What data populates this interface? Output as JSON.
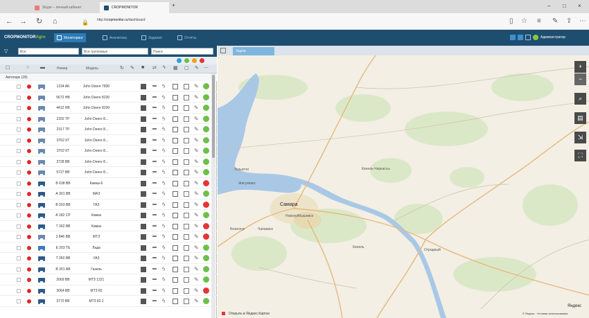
{
  "browser": {
    "tabs": [
      {
        "label": "Skype – личный кабинет",
        "active": false
      },
      {
        "label": "CROPMONITOR",
        "active": true
      }
    ],
    "url_prefix": "http://",
    "url_host": "cropmonitor.ru",
    "url_path": "/dashboard"
  },
  "header": {
    "logo_main": "CROPMONITOR",
    "logo_sub": "Agro",
    "nav": [
      {
        "label": "Мониторинг",
        "active": true
      },
      {
        "label": "Аналитика",
        "active": false
      },
      {
        "label": "Задания",
        "active": false
      },
      {
        "label": "Отчёты",
        "active": false
      }
    ],
    "user": "Администратор"
  },
  "filters": {
    "group": "Все",
    "type": "Все групповые",
    "search_placeholder": "Поиск"
  },
  "status_dots": [
    "#2a9fe0",
    "#6cc04a",
    "#f0a020",
    "#e43535"
  ],
  "columns": {
    "plate": "Номер",
    "model": "Модель"
  },
  "group_label": "Автопарк (28)",
  "vehicles": [
    {
      "kind": "tractor",
      "plate": "1234 AK",
      "model": "John Deere 7830",
      "ok": true
    },
    {
      "kind": "tractor",
      "plate": "5672 НВ",
      "model": "John Deere 8230",
      "ok": true
    },
    {
      "kind": "tractor",
      "plate": "4412 НВ",
      "model": "John Deere 8230",
      "ok": true
    },
    {
      "kind": "tractor",
      "plate": "2202 ТР",
      "model": "John Deere 8...",
      "ok": true
    },
    {
      "kind": "tractor",
      "plate": "2317 ТР",
      "model": "John Deere 8...",
      "ok": true
    },
    {
      "kind": "tractor",
      "plate": "0762 КТ",
      "model": "John Deere 8...",
      "ok": true
    },
    {
      "kind": "tractor",
      "plate": "3702 КТ",
      "model": "John Deere 8...",
      "ok": true
    },
    {
      "kind": "tractor",
      "plate": "3728 ВВ",
      "model": "John Deere 8...",
      "ok": true
    },
    {
      "kind": "tractor",
      "plate": "5727 ВВ",
      "model": "John Deere 8...",
      "ok": true
    },
    {
      "kind": "truck",
      "plate": "В 638 ВВ",
      "model": "Камаз-6",
      "ok": false
    },
    {
      "kind": "truck",
      "plate": "А 901 ВВ",
      "model": "МАЗ",
      "ok": true
    },
    {
      "kind": "truck",
      "plate": "В 503 ВВ",
      "model": "ГАЗ",
      "ok": false
    },
    {
      "kind": "truck",
      "plate": "А 182 СР",
      "model": "Камаз",
      "ok": true
    },
    {
      "kind": "truck",
      "plate": "Т 302 ВВ",
      "model": "Камаз",
      "ok": false
    },
    {
      "kind": "tractor",
      "plate": "3 846 ВВ",
      "model": "МТЗ",
      "ok": false
    },
    {
      "kind": "car",
      "plate": "Е 203 ТЕ",
      "model": "Лада",
      "ok": true
    },
    {
      "kind": "truck",
      "plate": "Т 350 ВВ",
      "model": "УАЗ",
      "ok": true
    },
    {
      "kind": "truck",
      "plate": "В 301 АВ",
      "model": "Газель",
      "ok": true
    },
    {
      "kind": "truck",
      "plate": "2069 ВВ",
      "model": "МТЗ 1221",
      "ok": true
    },
    {
      "kind": "truck",
      "plate": "3064 ВВ",
      "model": "МТЗ 82",
      "ok": false
    },
    {
      "kind": "truck",
      "plate": "3770 ВВ",
      "model": "МТЗ 82.1",
      "ok": true
    }
  ],
  "map": {
    "tab_label": "Карта",
    "labels": [
      {
        "text": "Самара",
        "type": "city"
      },
      {
        "text": "Новокуйбышевск",
        "type": "town"
      },
      {
        "text": "Тольятти",
        "type": "town"
      },
      {
        "text": "Жигулёвск",
        "type": "town"
      },
      {
        "text": "Чапаевск",
        "type": "town"
      },
      {
        "text": "Кинель",
        "type": "town"
      },
      {
        "text": "Безенчук",
        "type": "town"
      },
      {
        "text": "Отрадный",
        "type": "town"
      },
      {
        "text": "Кинель-Черкассы",
        "type": "town"
      }
    ],
    "footer_left": "Открыть в Яндекс.Картах",
    "footer_right": "© Яндекс · Условия использования",
    "brand": "Яндекс"
  }
}
